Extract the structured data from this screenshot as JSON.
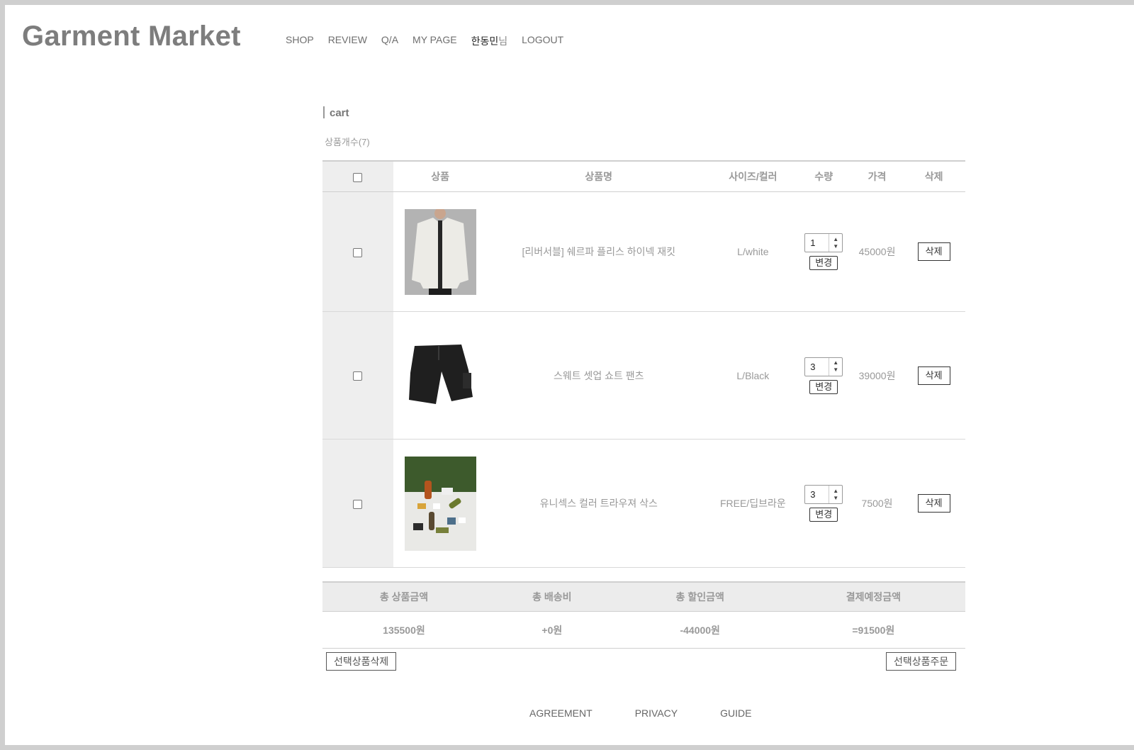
{
  "header": {
    "logo": "Garment Market",
    "nav": {
      "shop": "SHOP",
      "review": "REVIEW",
      "qa": "Q/A",
      "mypage": "MY PAGE",
      "user_name": "한동민",
      "user_suffix": "님",
      "logout": "LOGOUT"
    }
  },
  "cart": {
    "title": "cart",
    "item_count": "상품개수(7)",
    "columns": {
      "product": "상품",
      "name": "상품명",
      "size_color": "사이즈/컬러",
      "quantity": "수량",
      "price": "가격",
      "delete": "삭제"
    },
    "items": [
      {
        "name": "[리버서블] 쉐르파 플리스 하이넥 재킷",
        "size_color": "L/white",
        "quantity": "1",
        "price": "45000원",
        "change_label": "변경",
        "delete_label": "삭제",
        "image": "white-fleece-jacket"
      },
      {
        "name": "스웨트 셋업 쇼트 팬츠",
        "size_color": "L/Black",
        "quantity": "3",
        "price": "39000원",
        "change_label": "변경",
        "delete_label": "삭제",
        "image": "black-shorts"
      },
      {
        "name": "유니섹스 컬러 트라우져 삭스",
        "size_color": "FREE/딥브라운",
        "quantity": "3",
        "price": "7500원",
        "change_label": "변경",
        "delete_label": "삭제",
        "image": "colorful-socks"
      }
    ]
  },
  "summary": {
    "headers": {
      "total_product": "총 상품금액",
      "total_shipping": "총 배송비",
      "total_discount": "총 할인금액",
      "expected_payment": "결제예정금액"
    },
    "values": {
      "total_product": "135500원",
      "total_shipping": "+0원",
      "total_discount": "-44000원",
      "expected_payment": "=91500원"
    }
  },
  "actions": {
    "delete_selected": "선택상품삭제",
    "order_selected": "선택상품주문"
  },
  "footer": {
    "agreement": "AGREEMENT",
    "privacy": "PRIVACY",
    "guide": "GUIDE"
  }
}
